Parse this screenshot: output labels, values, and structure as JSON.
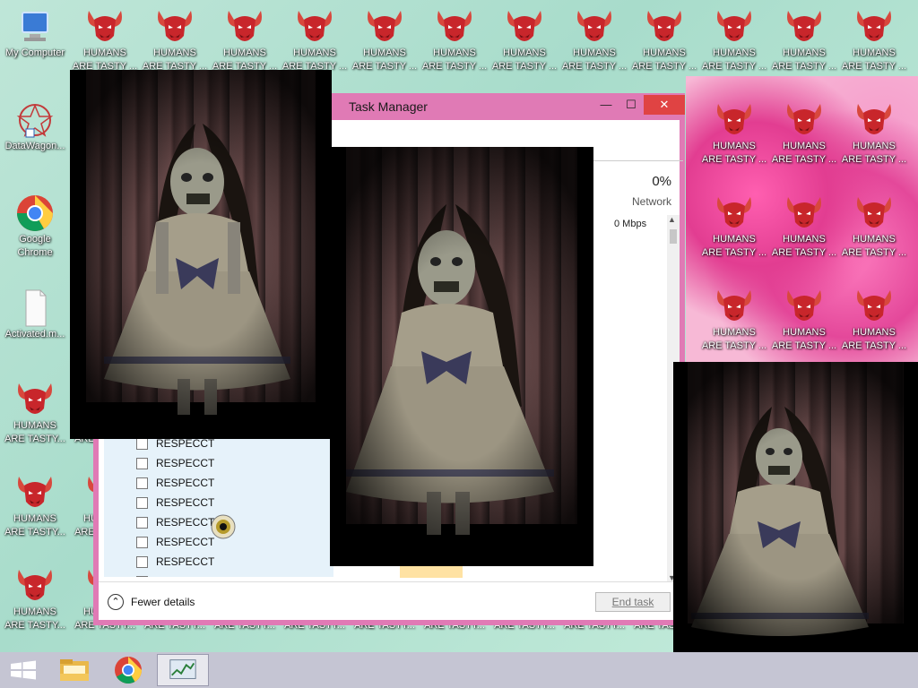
{
  "desktop": {
    "icons_left": [
      {
        "label": "My Computer",
        "icon": "computer-icon"
      },
      {
        "label": "DataWagon...",
        "icon": "datawagon-icon"
      },
      {
        "label": "Google Chrome",
        "icon": "chrome-icon"
      },
      {
        "label": "Activated.m...",
        "icon": "file-icon"
      }
    ],
    "demon_label_line1": "HUMANS",
    "demon_label_line2": "ARE TASTY ...",
    "demon_label_line2_short": "ARE TASTY...",
    "demon_icon": "demon-icon"
  },
  "task_manager": {
    "title": "Task Manager",
    "min_glyph": "—",
    "max_glyph": "☐",
    "close_glyph": "✕",
    "network_percent": "0%",
    "network_label": "Network",
    "network_value": "0 Mbps",
    "process_rows": [
      "RESPECCT",
      "RESPECCT",
      "RESPECCT",
      "RESPECCT",
      "RESPECCT",
      "RESPECCT",
      "RESPECCT",
      "RESPECCT"
    ],
    "fewer_details": "Fewer details",
    "end_task": "End task"
  },
  "colors": {
    "titlebar": "#e07ab5",
    "close": "#e04343",
    "taskbar": "#c5c5d3",
    "demon_red": "#c8262b"
  },
  "taskbar": {
    "items": [
      "windows-start-icon",
      "file-explorer-icon",
      "chrome-icon",
      "task-manager-icon"
    ]
  }
}
